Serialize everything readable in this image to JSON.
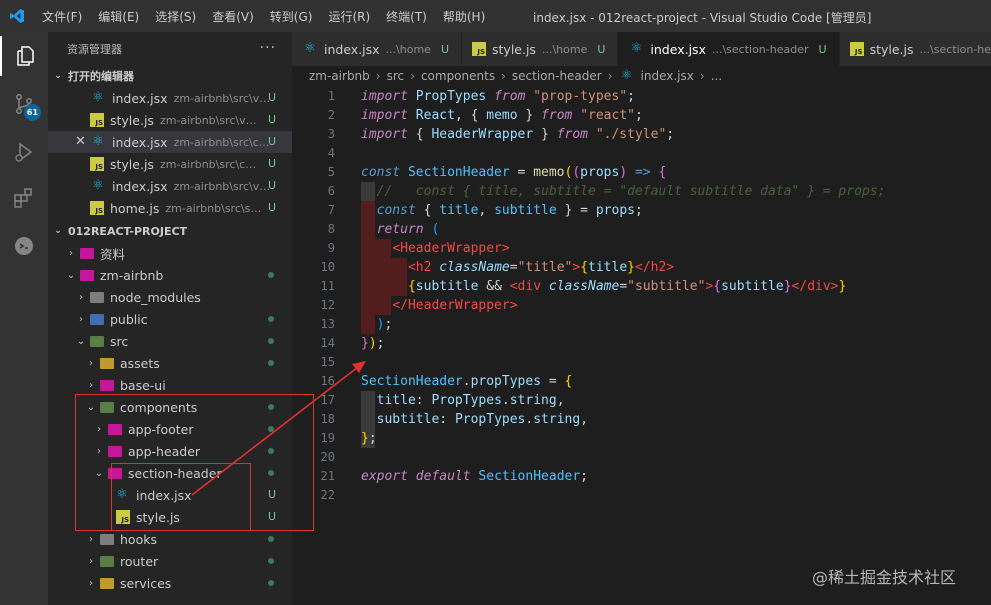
{
  "titlebar": {
    "menu": [
      "文件(F)",
      "编辑(E)",
      "选择(S)",
      "查看(V)",
      "转到(G)",
      "运行(R)",
      "终端(T)",
      "帮助(H)"
    ],
    "window_title": "index.jsx - 012react-project - Visual Studio Code [管理员]"
  },
  "activitybar": {
    "items": [
      {
        "name": "explorer-icon"
      },
      {
        "name": "source-control-icon",
        "badge": "61"
      },
      {
        "name": "run-debug-icon"
      },
      {
        "name": "extensions-icon"
      },
      {
        "name": "chat-icon"
      }
    ]
  },
  "sidebar": {
    "title": "资源管理器",
    "more": "···",
    "open_editors": {
      "label": "打开的编辑器",
      "items": [
        {
          "name": "index.jsx",
          "desc": "zm-airbnb\\src\\vi...",
          "status": "U",
          "icon": "react"
        },
        {
          "name": "style.js",
          "desc": "zm-airbnb\\src\\vie...",
          "status": "U",
          "icon": "js"
        },
        {
          "name": "index.jsx",
          "desc": "zm-airbnb\\src\\c...",
          "status": "U",
          "icon": "react",
          "selected": true,
          "close": "✕"
        },
        {
          "name": "style.js",
          "desc": "zm-airbnb\\src\\co...",
          "status": "U",
          "icon": "js"
        },
        {
          "name": "index.jsx",
          "desc": "zm-airbnb\\src\\vi...",
          "status": "U",
          "icon": "react"
        },
        {
          "name": "home.js",
          "desc": "zm-airbnb\\src\\st...",
          "status": "U",
          "icon": "js"
        }
      ]
    },
    "project": {
      "label": "012REACT-PROJECT",
      "tree": [
        {
          "label": "资料",
          "chev": "›",
          "icon": "folder-pink",
          "dot": false
        },
        {
          "label": "zm-airbnb",
          "chev": "⌄",
          "icon": "folder-pink",
          "dot": true
        },
        {
          "label": "node_modules",
          "chev": "›",
          "icon": "folder-gray",
          "dot": false
        },
        {
          "label": "public",
          "chev": "›",
          "icon": "folder-blue",
          "dot": true
        },
        {
          "label": "src",
          "chev": "⌄",
          "icon": "folder-green",
          "dot": true
        },
        {
          "label": "assets",
          "chev": "›",
          "icon": "folder-yellow",
          "dot": true
        },
        {
          "label": "base-ui",
          "chev": "›",
          "icon": "folder-pink",
          "dot": false
        },
        {
          "label": "components",
          "chev": "⌄",
          "icon": "folder-green",
          "dot": true
        },
        {
          "label": "app-footer",
          "chev": "›",
          "icon": "folder-pink",
          "dot": true
        },
        {
          "label": "app-header",
          "chev": "›",
          "icon": "folder-pink",
          "dot": true
        },
        {
          "label": "section-header",
          "chev": "⌄",
          "icon": "folder-pink",
          "dot": true
        },
        {
          "label": "index.jsx",
          "chev": "",
          "icon": "react",
          "status": "U"
        },
        {
          "label": "style.js",
          "chev": "",
          "icon": "js",
          "status": "U"
        },
        {
          "label": "hooks",
          "chev": "›",
          "icon": "folder-gray",
          "dot": true
        },
        {
          "label": "router",
          "chev": "›",
          "icon": "folder-green",
          "dot": true
        },
        {
          "label": "services",
          "chev": "›",
          "icon": "folder-yellow",
          "dot": true
        }
      ]
    }
  },
  "tabs": [
    {
      "name": "index.jsx",
      "desc": "...\\home",
      "status": "U",
      "icon": "react"
    },
    {
      "name": "style.js",
      "desc": "...\\home",
      "status": "U",
      "icon": "js"
    },
    {
      "name": "index.jsx",
      "desc": "...\\section-header",
      "status": "U",
      "icon": "react",
      "active": true
    },
    {
      "name": "style.js",
      "desc": "...\\section-hea",
      "status": "",
      "icon": "js"
    }
  ],
  "breadcrumb": [
    "zm-airbnb",
    "src",
    "components",
    "section-header",
    "index.jsx",
    "..."
  ],
  "editor": {
    "line_numbers": [
      "1",
      "2",
      "3",
      "4",
      "5",
      "6",
      "7",
      "8",
      "9",
      "10",
      "11",
      "12",
      "13",
      "14",
      "15",
      "16",
      "17",
      "18",
      "19",
      "20",
      "21",
      "22"
    ]
  },
  "watermark": "@稀土掘金技术社区",
  "colors": {
    "accent": "#007acc",
    "untracked": "#73c991",
    "annotation": "#e03131"
  }
}
